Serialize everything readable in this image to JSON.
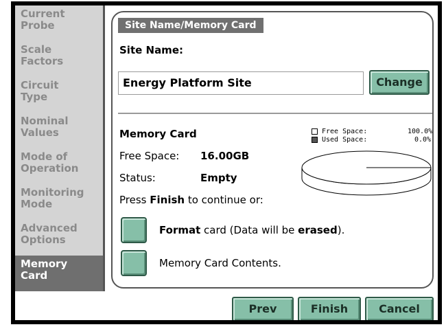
{
  "sidebar": {
    "items": [
      {
        "label": "Current\nProbe"
      },
      {
        "label": "Scale\nFactors"
      },
      {
        "label": "Circuit\nType"
      },
      {
        "label": "Nominal\nValues"
      },
      {
        "label": "Mode of\nOperation"
      },
      {
        "label": "Monitoring\nMode"
      },
      {
        "label": "Advanced\nOptions"
      },
      {
        "label": "Memory\nCard"
      }
    ],
    "active_index": 7
  },
  "panel": {
    "title": "Site Name/Memory Card",
    "site_name_label": "Site Name:",
    "site_name_value": "Energy Platform Site",
    "change_label": "Change",
    "memory_card_heading": "Memory Card",
    "free_space_label": "Free Space:",
    "free_space_value": "16.00GB",
    "status_label": "Status:",
    "status_value": "Empty",
    "instruction_pre": "Press ",
    "instruction_bold": "Finish",
    "instruction_post": " to continue or:",
    "format_bold": "Format",
    "format_mid": " card (Data will be ",
    "format_bold2": "erased",
    "format_post": ").",
    "contents_label": "Memory Card Contents."
  },
  "legend": {
    "free_label": "Free Space:",
    "free_value": "100.0%",
    "used_label": "Used Space:",
    "used_value": "0.0%"
  },
  "chart_data": {
    "type": "pie",
    "categories": [
      "Free Space",
      "Used Space"
    ],
    "values": [
      100.0,
      0.0
    ]
  },
  "footer": {
    "prev_label": "Prev",
    "finish_label": "Finish",
    "cancel_label": "Cancel"
  },
  "colors": {
    "button_green": "#86bfa8",
    "active_sidebar": "#6f6f6f",
    "inactive_sidebar_text": "#8a8a8a"
  }
}
